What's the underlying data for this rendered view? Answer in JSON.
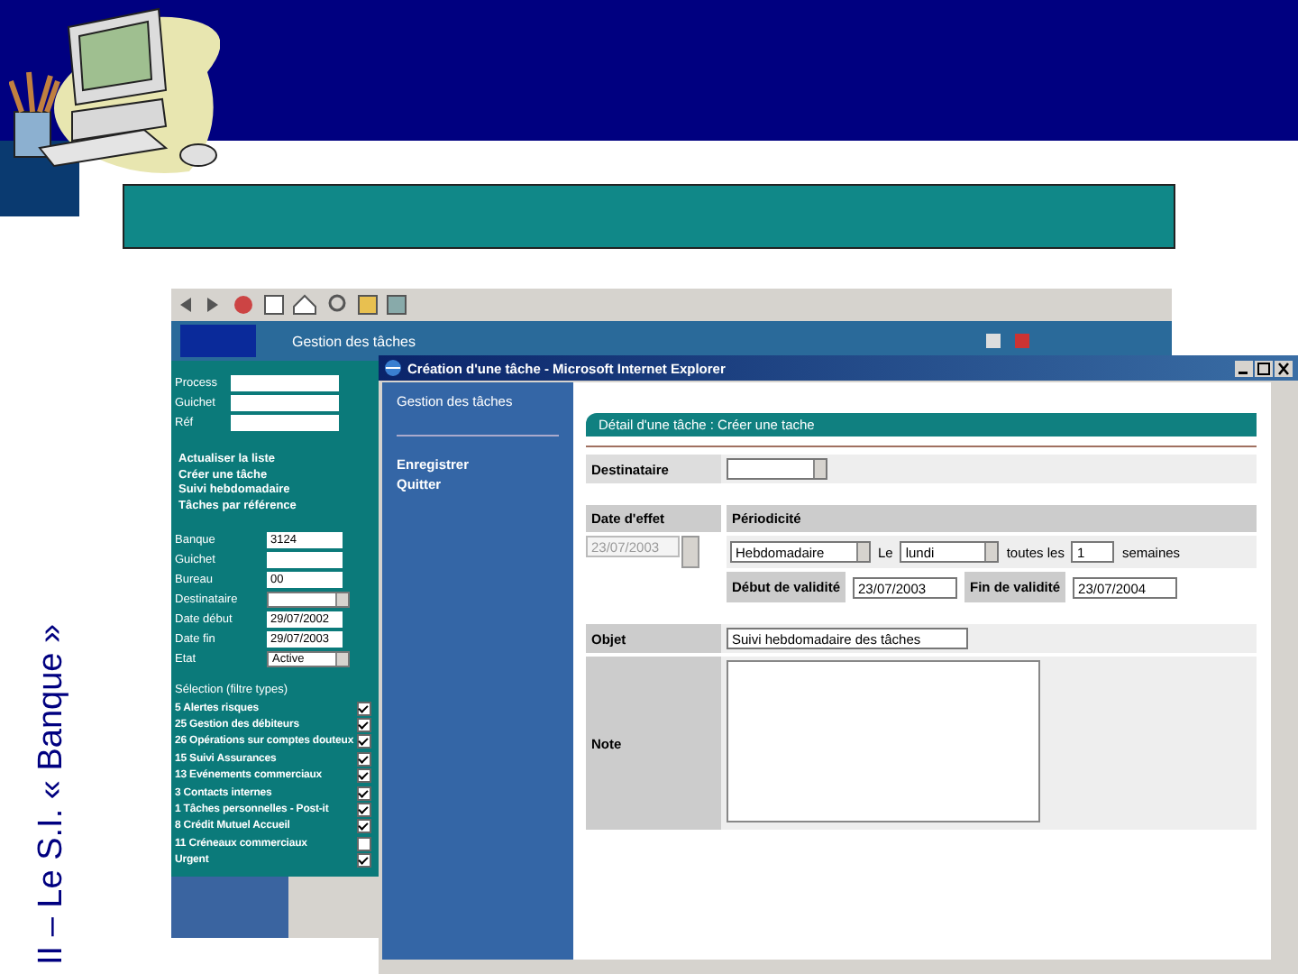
{
  "slide": {
    "side_title": "II – Le S.I. « Banque »"
  },
  "back_window": {
    "app_title": "Gestion des tâches",
    "filters": [
      {
        "label": "Process"
      },
      {
        "label": "Guichet"
      },
      {
        "label": "Réf"
      }
    ],
    "links": [
      "Actualiser la liste",
      "Créer une tâche",
      "Suivi hebdomadaire",
      "Tâches par référence"
    ],
    "fields": [
      {
        "label": "Banque",
        "value": "3124",
        "kind": "input"
      },
      {
        "label": "Guichet",
        "kind": "input"
      },
      {
        "label": "Bureau",
        "value": "00",
        "kind": "input"
      },
      {
        "label": "Destinataire",
        "kind": "select"
      },
      {
        "label": "Date début",
        "value": "29/07/2002",
        "kind": "input"
      },
      {
        "label": "Date fin",
        "value": "29/07/2003",
        "kind": "input"
      },
      {
        "label": "Etat",
        "value": "Active",
        "kind": "select"
      }
    ],
    "selection_label": "Sélection (filtre types)",
    "types": [
      {
        "label": "5 Alertes risques",
        "checked": true
      },
      {
        "label": "25 Gestion des débiteurs",
        "checked": true
      },
      {
        "label": "26 Opérations sur comptes douteux",
        "checked": true
      },
      {
        "label": "15 Suivi Assurances",
        "checked": true
      },
      {
        "label": "13 Evénements commerciaux",
        "checked": true
      },
      {
        "label": "3 Contacts internes",
        "checked": true
      },
      {
        "label": "1 Tâches personnelles - Post-it",
        "checked": true
      },
      {
        "label": "8 Crédit Mutuel Accueil",
        "checked": true
      },
      {
        "label": "11 Créneaux commerciaux",
        "checked": false
      },
      {
        "label": "Urgent",
        "checked": true
      }
    ]
  },
  "front_window": {
    "title": "Création d'une tâche - Microsoft Internet Explorer",
    "nav_heading": "Gestion des tâches",
    "nav_items": [
      "Enregistrer",
      "Quitter"
    ],
    "panel_title": "Détail d'une tâche : Créer une tache",
    "recipient_label": "Destinataire",
    "date_label": "Date d'effet",
    "date_value": "23/07/2003",
    "periodicity_label": "Périodicité",
    "frequency": "Hebdomadaire",
    "day_label": "Le",
    "day": "lundi",
    "every_label": "toutes les",
    "every_value": "1",
    "unit": "semaines",
    "start_label": "Début de validité",
    "start_value": "23/07/2003",
    "end_label": "Fin de validité",
    "end_value": "23/07/2004",
    "subject_label": "Objet",
    "subject_value": "Suivi hebdomadaire des tâches",
    "note_label": "Note"
  }
}
